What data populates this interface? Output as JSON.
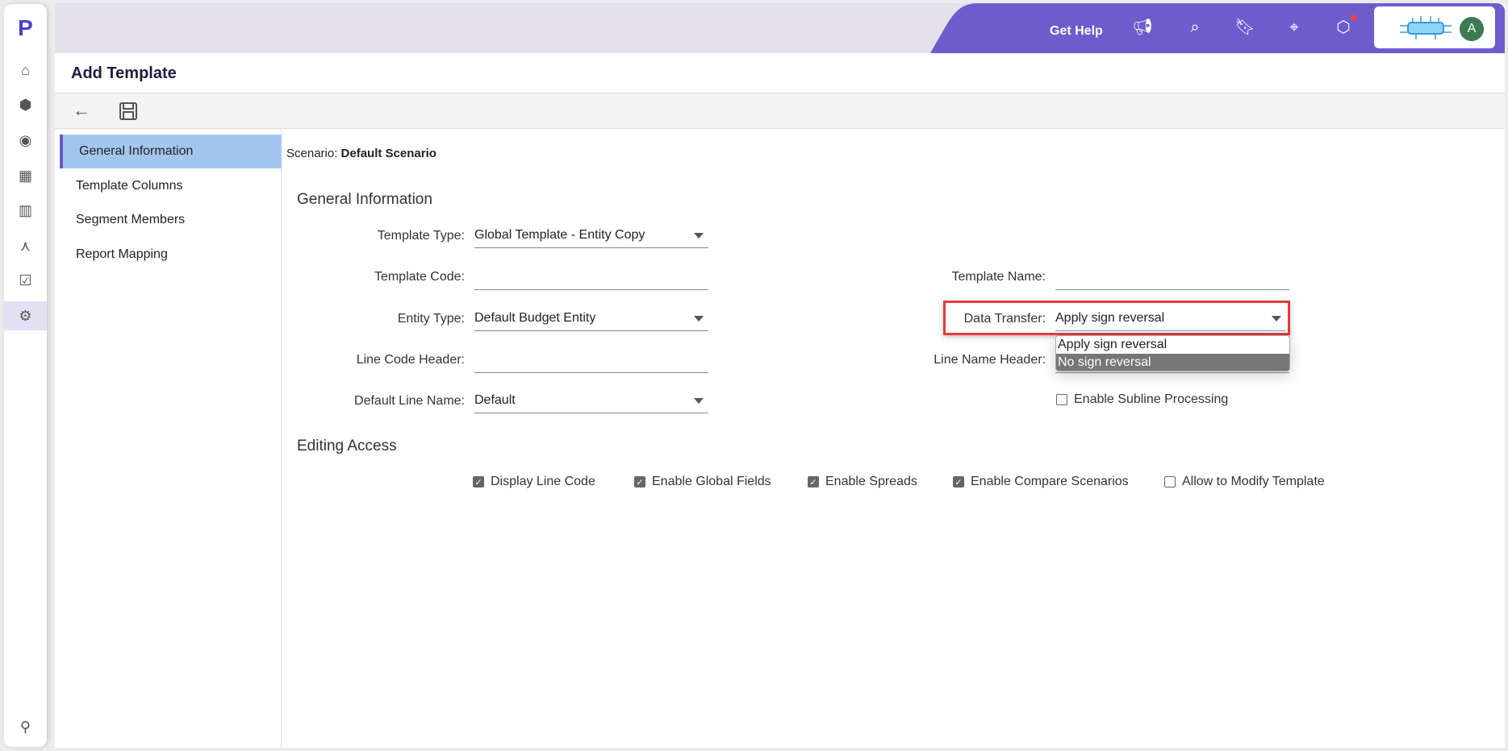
{
  "header": {
    "get_help": "Get Help",
    "avatar_initial": "A",
    "accent": "#6e5ccd"
  },
  "page": {
    "title": "Add Template"
  },
  "nav": {
    "items": [
      {
        "label": "General Information"
      },
      {
        "label": "Template Columns"
      },
      {
        "label": "Segment Members"
      },
      {
        "label": "Report Mapping"
      }
    ]
  },
  "scenario": {
    "label": "Scenario:",
    "value": "Default Scenario"
  },
  "general": {
    "heading": "General Information",
    "template_type": {
      "label": "Template Type:",
      "value": "Global Template - Entity Copy"
    },
    "template_code": {
      "label": "Template Code:",
      "value": ""
    },
    "entity_type": {
      "label": "Entity Type:",
      "value": "Default Budget Entity"
    },
    "line_code_header": {
      "label": "Line Code Header:",
      "value": ""
    },
    "default_line_name": {
      "label": "Default Line Name:",
      "value": "Default"
    },
    "template_name": {
      "label": "Template Name:",
      "value": ""
    },
    "data_transfer": {
      "label": "Data Transfer:",
      "value": "Apply sign reversal",
      "options": [
        "Apply sign reversal",
        "No sign reversal"
      ],
      "highlighted": "No sign reversal"
    },
    "line_name_header": {
      "label": "Line Name Header:",
      "value": ""
    },
    "subline": {
      "label": "Enable Subline Processing",
      "checked": false
    }
  },
  "editing": {
    "heading": "Editing Access",
    "options": [
      {
        "label": "Display Line Code",
        "checked": true
      },
      {
        "label": "Enable Global Fields",
        "checked": true
      },
      {
        "label": "Enable Spreads",
        "checked": true
      },
      {
        "label": "Enable Compare Scenarios",
        "checked": true
      },
      {
        "label": "Allow to Modify Template",
        "checked": false
      }
    ]
  }
}
